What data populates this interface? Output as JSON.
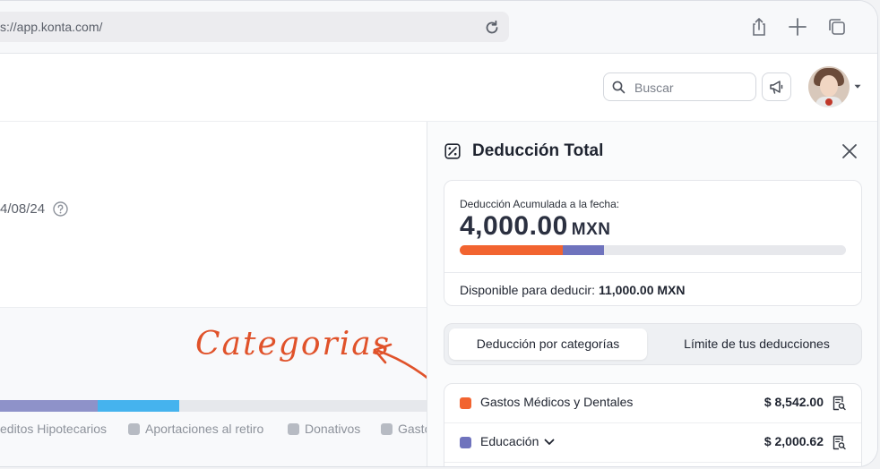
{
  "browser": {
    "url": "s://app.konta.com/",
    "icons": [
      "reload-icon",
      "share-icon",
      "new-tab-icon",
      "tabs-overview-icon"
    ]
  },
  "header": {
    "search_placeholder": "Buscar",
    "icons": [
      "search-icon",
      "megaphone-icon",
      "avatar",
      "chevron-down-icon"
    ]
  },
  "background": {
    "date_text": "4/08/24",
    "legend": [
      "editos Hipotecarios",
      "Aportaciones al retiro",
      "Donativos",
      "Gasto"
    ],
    "bar_segments": [
      {
        "color": "#8e92c9",
        "fraction": 0.228
      },
      {
        "color": "#45b3ee",
        "fraction": 0.193
      }
    ],
    "annotation": "Categorias",
    "annotation_color": "#e0522a"
  },
  "panel": {
    "title": "Deducción Total",
    "summary": {
      "label": "Deducción Acumulada a la fecha:",
      "amount": "4,000.00",
      "currency": "MXN",
      "bar": [
        {
          "color": "#f26430",
          "fraction": 0.267
        },
        {
          "color": "#6f73bd",
          "fraction": 0.106
        }
      ],
      "available_label": "Disponible para deducir:",
      "available_value": "11,000.00 MXN"
    },
    "tabs": [
      {
        "label": "Deducción por categorías",
        "active": true
      },
      {
        "label": "Límite de tus deducciones",
        "active": false
      }
    ],
    "categories": [
      {
        "label": "Gastos Médicos y Dentales",
        "amount": "$ 8,542.00",
        "color": "#f26430"
      },
      {
        "label": "Educación",
        "amount": "$ 2,000.62",
        "color": "#6f73bd"
      }
    ]
  }
}
